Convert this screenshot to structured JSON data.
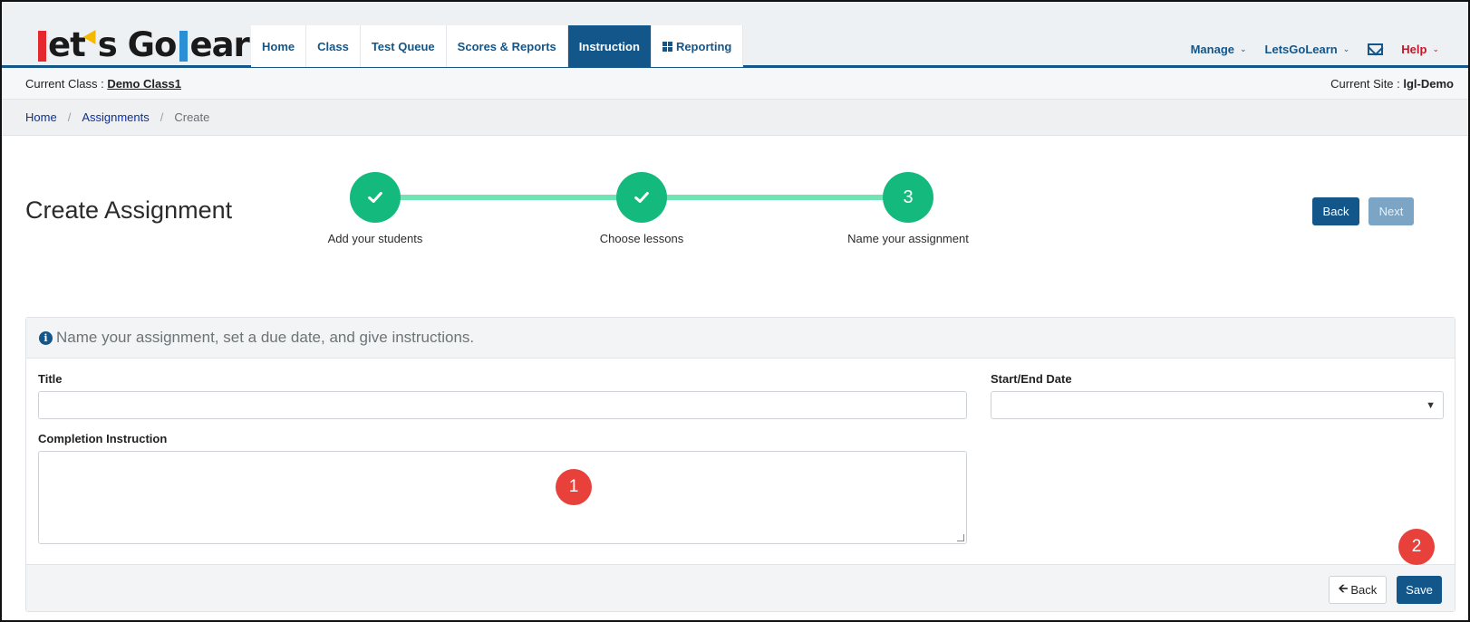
{
  "logo": {
    "text_a": "et",
    "text_b": "s Go",
    "text_c": "earn"
  },
  "tabs": [
    {
      "label": "Home"
    },
    {
      "label": "Class"
    },
    {
      "label": "Test Queue"
    },
    {
      "label": "Scores & Reports"
    },
    {
      "label": "Instruction",
      "active": true
    },
    {
      "label": "Reporting",
      "icon": "grid-icon"
    }
  ],
  "rightnav": {
    "manage": "Manage",
    "user": "LetsGoLearn",
    "help": "Help"
  },
  "classbar": {
    "class_label": "Current Class : ",
    "class_name": "Demo Class1",
    "site_label": "Current Site : ",
    "site_name": "lgl-Demo"
  },
  "breadcrumb": {
    "home": "Home",
    "assignments": "Assignments",
    "current": "Create",
    "sep": "/"
  },
  "page": {
    "title": "Create Assignment"
  },
  "stepper": {
    "steps": [
      {
        "label": "Add your students",
        "state": "done",
        "icon": "check-icon"
      },
      {
        "label": "Choose lessons",
        "state": "done",
        "icon": "check-icon"
      },
      {
        "label": "Name your assignment",
        "state": "current",
        "number": "3"
      }
    ]
  },
  "header_buttons": {
    "back": "Back",
    "next": "Next"
  },
  "panel": {
    "heading": "Name your assignment, set a due date, and give instructions.",
    "title_label": "Title",
    "title_value": "",
    "date_label": "Start/End Date",
    "date_value": "",
    "instruction_label": "Completion Instruction",
    "instruction_value": "",
    "back": "Back",
    "save": "Save"
  },
  "markers": {
    "m1": "1",
    "m2": "2"
  },
  "colors": {
    "brand": "#13568a",
    "step_done": "#14b97d",
    "step_line": "#72e3b5",
    "marker": "#e8413c",
    "help": "#c0182a"
  }
}
